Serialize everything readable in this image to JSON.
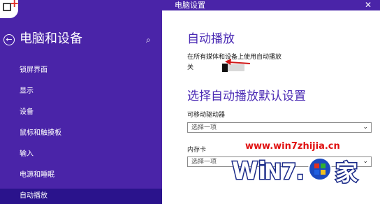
{
  "window": {
    "title": "电脑设置",
    "close_icon": "close-icon"
  },
  "sidebar": {
    "title": "电脑和设备",
    "items": [
      {
        "label": "锁屏界面"
      },
      {
        "label": "显示"
      },
      {
        "label": "设备"
      },
      {
        "label": "鼠标和触摸板"
      },
      {
        "label": "输入"
      },
      {
        "label": "电源和睡眠"
      },
      {
        "label": "自动播放"
      }
    ]
  },
  "main": {
    "autoplay_heading": "自动播放",
    "autoplay_desc": "在所有媒体和设备上使用自动播放",
    "toggle_state": "关",
    "defaults_heading": "选择自动播放默认设置",
    "removable_label": "可移动驱动器",
    "removable_value": "选择一项",
    "memcard_label": "内存卡",
    "memcard_value": "选择一项"
  },
  "watermark": {
    "url": "www.win7zhijia.cn"
  },
  "colors": {
    "accent": "#4a24a8",
    "active_item": "#2a138c",
    "heading": "#4a2ab4"
  }
}
